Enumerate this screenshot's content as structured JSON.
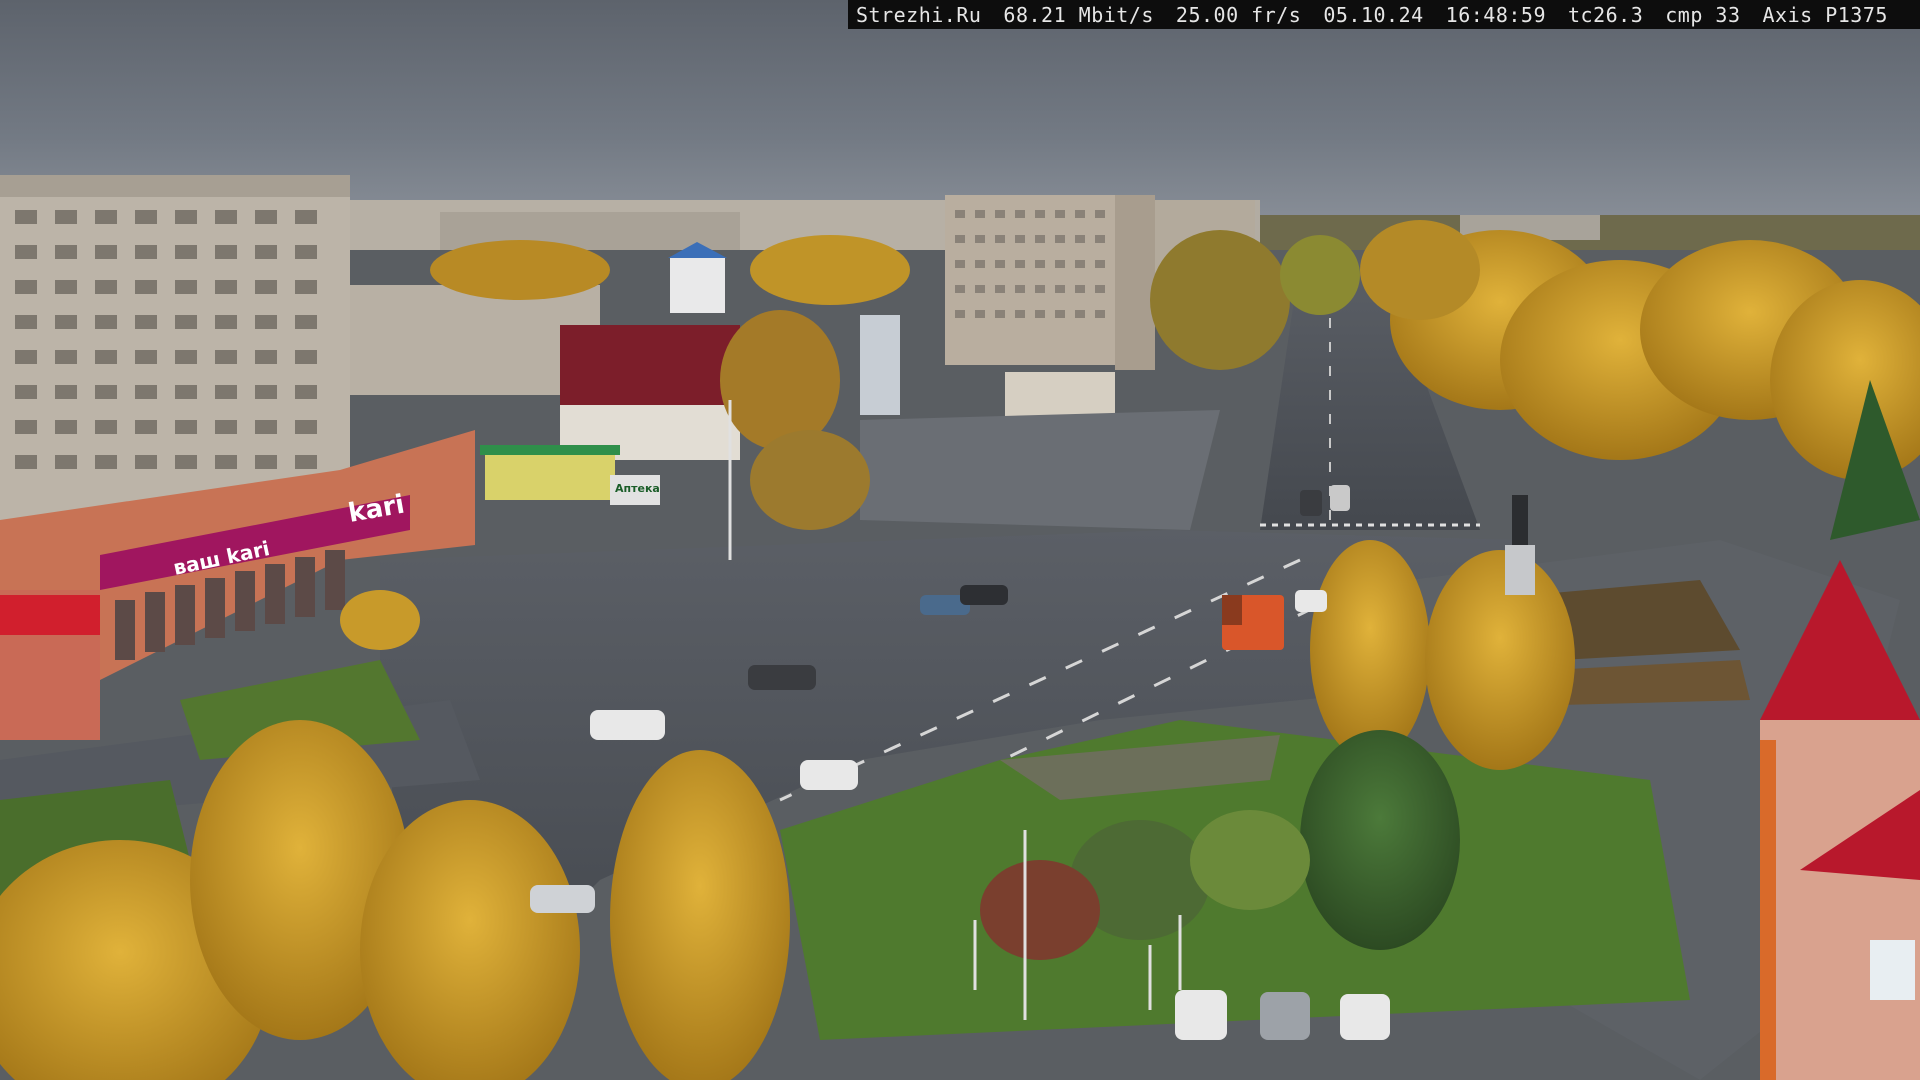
{
  "overlay": {
    "site": "Strezhi.Ru",
    "bitrate": "68.21 Mbit/s",
    "framerate": "25.00 fr/s",
    "date": "05.10.24",
    "time": "16:48:59",
    "tc": "tc26.3",
    "cmp": "cmp 33",
    "camera": "Axis P1375"
  },
  "signage": {
    "store_brand": "kari",
    "store_banner": "ваш kari",
    "pharmacy_sign": "Аптека"
  },
  "colors": {
    "sky": "#6d737c",
    "foliage_gold": "#c89a2a",
    "grass": "#4f7a2e",
    "asphalt": "#4b4f55",
    "kari_magenta": "#a0165f",
    "overlay_bg": "#0d0d0d",
    "overlay_text": "#e6e6e6"
  }
}
